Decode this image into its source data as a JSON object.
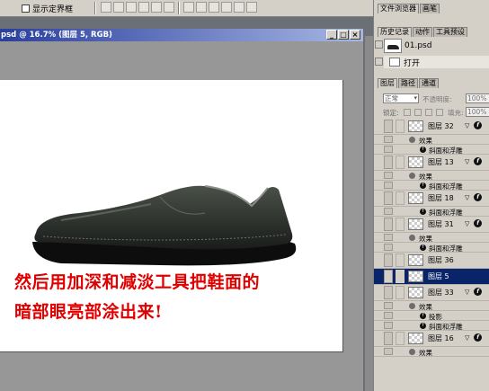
{
  "options_bar": {
    "show_bbox_label": "显示定界框"
  },
  "document": {
    "title": "psd @ 16.7% (图层 5, RGB)",
    "min_btn": "_",
    "max_btn": "□",
    "close_btn": "×",
    "caption_line1": "然后用加深和减淡工具把鞋面的",
    "caption_line2": "暗部眼亮部涂出来!"
  },
  "top_tabs": [
    "文件浏览器",
    "画笔"
  ],
  "history_panel": {
    "tabs": [
      "历史记录",
      "动作",
      "工具预设"
    ],
    "snapshot_name": "01.psd",
    "step_label": "打开"
  },
  "layers_panel": {
    "tabs": [
      "图层",
      "路径",
      "通道"
    ],
    "blend_mode": "正常",
    "opacity_label": "不透明度:",
    "opacity_value": "100%",
    "lock_label": "锁定:",
    "fill_label": "填充:",
    "fill_value": "100%",
    "rows": [
      {
        "kind": "layer",
        "name": "图层 32",
        "fx": true
      },
      {
        "kind": "effects",
        "label": "效果"
      },
      {
        "kind": "effect",
        "label": "斜面和浮雕"
      },
      {
        "kind": "layer",
        "name": "图层 13",
        "fx": true
      },
      {
        "kind": "effects",
        "label": "效果"
      },
      {
        "kind": "effect",
        "label": "斜面和浮雕"
      },
      {
        "kind": "layer",
        "name": "图层 18",
        "fx": true
      },
      {
        "kind": "effect",
        "label": "斜面和浮雕"
      },
      {
        "kind": "layer",
        "name": "图层 31",
        "fx": true
      },
      {
        "kind": "effects",
        "label": "效果"
      },
      {
        "kind": "effect",
        "label": "斜面和浮雕"
      },
      {
        "kind": "layer",
        "name": "图层 36",
        "fx": false
      },
      {
        "kind": "layer",
        "name": "图层 5",
        "fx": false,
        "selected": true
      },
      {
        "kind": "layer",
        "name": "图层 33",
        "fx": true
      },
      {
        "kind": "effects",
        "label": "效果"
      },
      {
        "kind": "effect",
        "label": "投影"
      },
      {
        "kind": "effect",
        "label": "斜面和浮雕"
      },
      {
        "kind": "layer",
        "name": "图层 16",
        "fx": true
      },
      {
        "kind": "effects",
        "label": "效果"
      }
    ]
  },
  "colors": {
    "titlebar": "#2a3f9e",
    "caption": "#e00000",
    "selection": "#0a246a"
  }
}
